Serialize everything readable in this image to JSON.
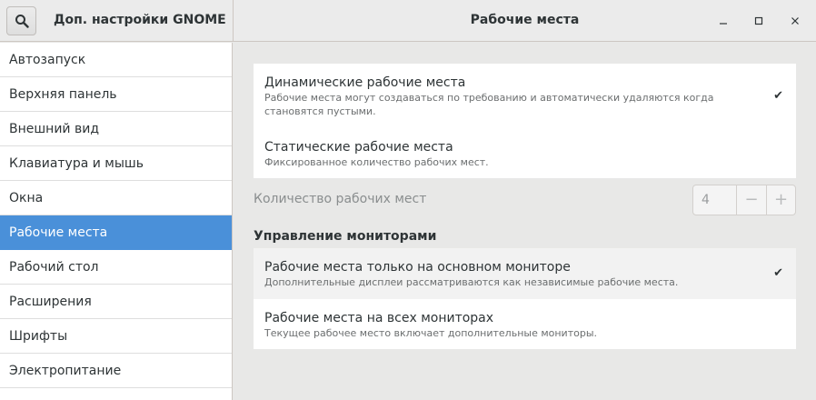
{
  "header": {
    "app_title": "Доп. настройки GNOME",
    "page_title": "Рабочие места",
    "search_icon": "search-icon",
    "minimize_icon": "minimize-icon",
    "maximize_icon": "maximize-icon",
    "close_icon": "close-icon"
  },
  "sidebar": {
    "items": [
      {
        "label": "Автозапуск"
      },
      {
        "label": "Верхняя панель"
      },
      {
        "label": "Внешний вид"
      },
      {
        "label": "Клавиатура и мышь"
      },
      {
        "label": "Окна"
      },
      {
        "label": "Рабочие места",
        "selected": true
      },
      {
        "label": "Рабочий стол"
      },
      {
        "label": "Расширения"
      },
      {
        "label": "Шрифты"
      },
      {
        "label": "Электропитание"
      }
    ]
  },
  "workspaces": {
    "dynamic": {
      "title": "Динамические рабочие места",
      "subtitle": "Рабочие места могут создаваться по требованию и автоматически удаляются когда становятся пустыми.",
      "checked": true
    },
    "static": {
      "title": "Статические рабочие места",
      "subtitle": "Фиксированное количество рабочих мест.",
      "checked": false
    },
    "count_label": "Количество рабочих мест",
    "count_value": "4",
    "minus": "−",
    "plus": "+"
  },
  "monitors": {
    "heading": "Управление мониторами",
    "primary_only": {
      "title": "Рабочие места только на основном мониторе",
      "subtitle": "Дополнительные дисплеи рассматриваются как независимые рабочие места.",
      "checked": true
    },
    "all_monitors": {
      "title": "Рабочие места на всех мониторах",
      "subtitle": "Текущее рабочее место включает дополнительные мониторы.",
      "checked": false
    }
  },
  "check_glyph": "✔",
  "colors": {
    "accent": "#4a90d9",
    "background": "#e8e8e7",
    "text": "#2e3436"
  }
}
